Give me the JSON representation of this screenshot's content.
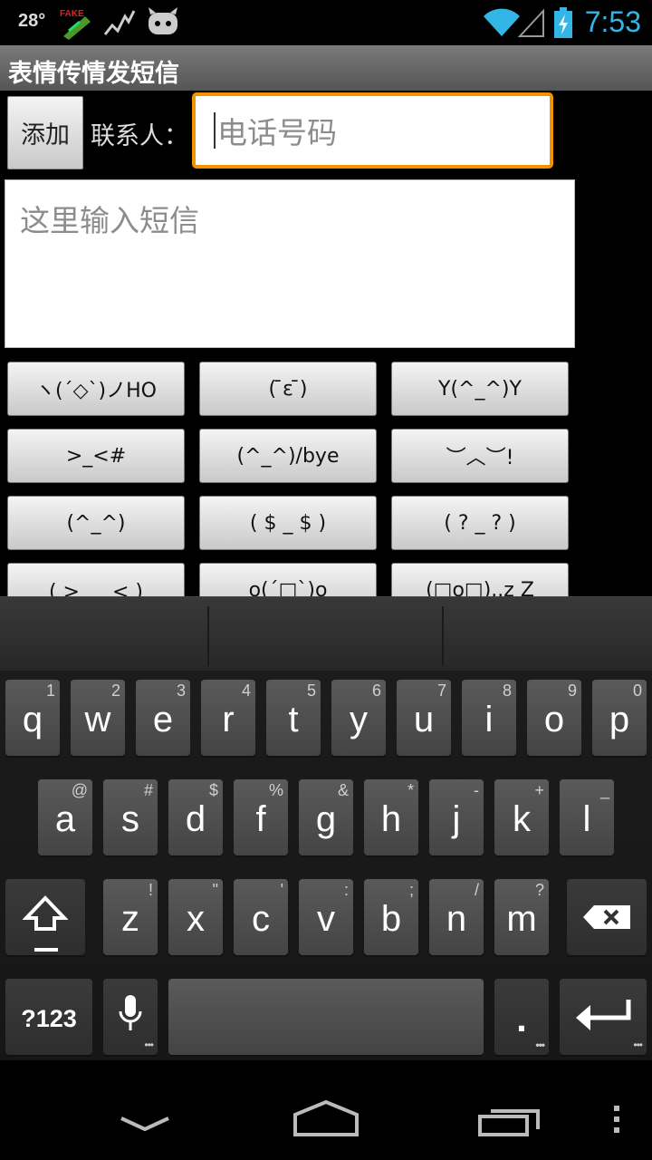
{
  "status_bar": {
    "temperature": "28°",
    "time": "7:53",
    "icons": [
      "fake-gps-icon",
      "activity-graph-icon",
      "cyanogen-mascot-icon",
      "wifi-icon",
      "signal-icon",
      "battery-charging-icon"
    ],
    "accent_color": "#33b5e5"
  },
  "app": {
    "title": "表情传情发短信"
  },
  "form": {
    "add_label": "添加",
    "contact_label": "联系人：",
    "phone_placeholder": "电话号码",
    "message_placeholder": "这里输入短信",
    "focus_color": "#f29400"
  },
  "emoticons": [
    "ヽ(ˊ◇ˋ)ノHO",
    "( ̄ε ̄)",
    "Y(^_^)Y",
    ">_<#",
    "(^_^)/bye",
    "︶︿︶!",
    "(^_^)",
    "( $ _ $ )",
    "( ? _ ? )",
    "( > ﹏ < )",
    "o(ˊ□ˋ)o",
    "(□o□)..z Z"
  ],
  "keyboard": {
    "row1": [
      {
        "key": "q",
        "hint": "1"
      },
      {
        "key": "w",
        "hint": "2"
      },
      {
        "key": "e",
        "hint": "3"
      },
      {
        "key": "r",
        "hint": "4"
      },
      {
        "key": "t",
        "hint": "5"
      },
      {
        "key": "y",
        "hint": "6"
      },
      {
        "key": "u",
        "hint": "7"
      },
      {
        "key": "i",
        "hint": "8"
      },
      {
        "key": "o",
        "hint": "9"
      },
      {
        "key": "p",
        "hint": "0"
      }
    ],
    "row2": [
      {
        "key": "a",
        "hint": "@"
      },
      {
        "key": "s",
        "hint": "#"
      },
      {
        "key": "d",
        "hint": "$"
      },
      {
        "key": "f",
        "hint": "%"
      },
      {
        "key": "g",
        "hint": "&"
      },
      {
        "key": "h",
        "hint": "*"
      },
      {
        "key": "j",
        "hint": "-"
      },
      {
        "key": "k",
        "hint": "+"
      },
      {
        "key": "l",
        "hint": "_"
      }
    ],
    "row3": [
      {
        "key": "z",
        "hint": "!"
      },
      {
        "key": "x",
        "hint": "\""
      },
      {
        "key": "c",
        "hint": "'"
      },
      {
        "key": "v",
        "hint": ":"
      },
      {
        "key": "b",
        "hint": ";"
      },
      {
        "key": "n",
        "hint": "/"
      },
      {
        "key": "m",
        "hint": "?"
      }
    ],
    "symbols_label": "?123",
    "period_label": ".",
    "shift_icon": "shift-icon",
    "delete_icon": "backspace-icon",
    "mic_icon": "microphone-icon",
    "enter_icon": "enter-icon"
  },
  "nav_bar": {
    "icons": [
      "back-icon",
      "home-icon",
      "recent-apps-icon",
      "menu-icon"
    ]
  }
}
